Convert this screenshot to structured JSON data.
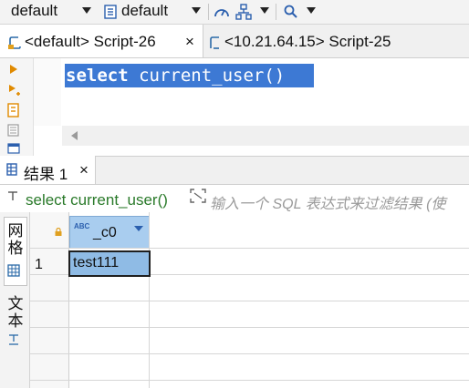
{
  "toolbar": {
    "datasource": "default",
    "schema": "default"
  },
  "tabs": [
    {
      "label": "<default> Script-26",
      "close": "×"
    },
    {
      "label": "<10.21.64.15> Script-25"
    }
  ],
  "editor": {
    "sql_keyword": "select",
    "sql_rest": " current_user()"
  },
  "results": {
    "tab_label": "结果 1",
    "tab_close": "×",
    "query_text": "select current_user()",
    "filter_placeholder": "输入一个 SQL 表达式来过滤结果 (使",
    "side_tab_grid": "网格",
    "side_tab_text": "文本",
    "columns": [
      {
        "type_badge": "ABC",
        "name": "_c0"
      }
    ],
    "rows": [
      {
        "num": "1",
        "values": [
          "test111"
        ]
      }
    ]
  },
  "colors": {
    "selection": "#3d79d4",
    "header": "#a9cdef",
    "selected_cell": "#8fbbe5",
    "accent_green": "#2a7a2a"
  }
}
